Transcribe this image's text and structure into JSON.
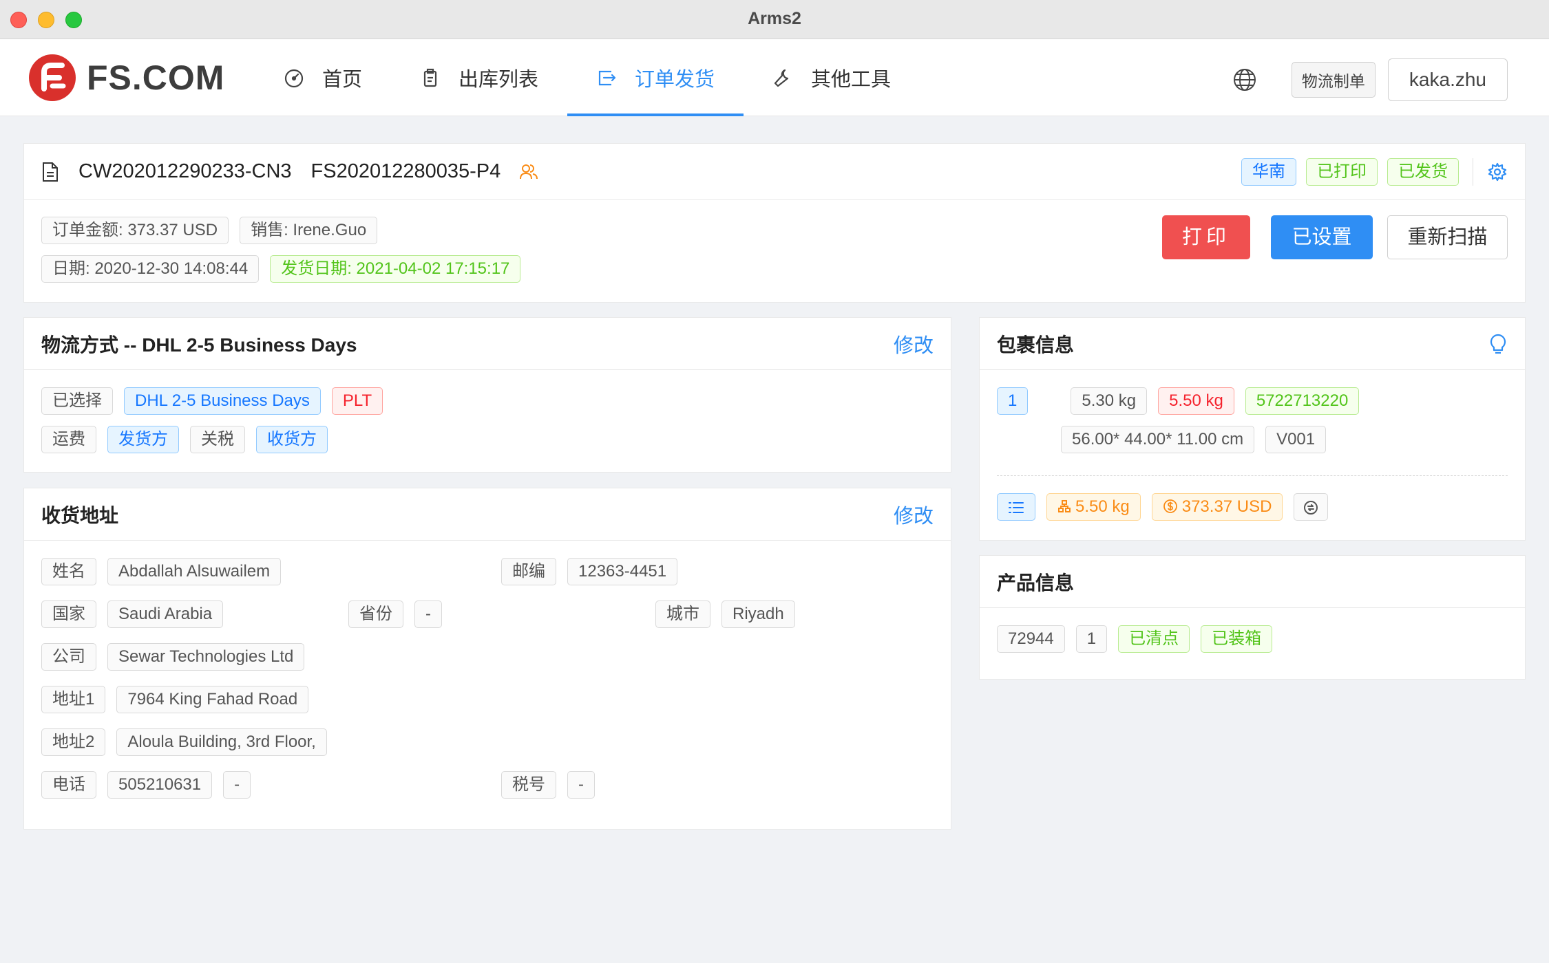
{
  "window": {
    "title": "Arms2"
  },
  "header": {
    "logo_text": "FS.COM",
    "nav": [
      {
        "label": "首页",
        "icon": "dashboard-icon"
      },
      {
        "label": "出库列表",
        "icon": "clipboard-icon"
      },
      {
        "label": "订单发货",
        "icon": "export-icon",
        "active": true
      },
      {
        "label": "其他工具",
        "icon": "wrench-icon"
      }
    ],
    "logistics_button": "物流制单",
    "user": "kaka.zhu"
  },
  "order": {
    "id": "CW202012290233-CN3",
    "ref": "FS202012280035-P4",
    "badges": [
      "华南",
      "已打印",
      "已发货"
    ],
    "amount": "订单金额: 373.37 USD",
    "sales": "销售: Irene.Guo",
    "date": "日期: 2020-12-30 14:08:44",
    "ship_date": "发货日期: 2021-04-02 17:15:17",
    "print_label": "打印",
    "set_label": "已设置",
    "rescan_label": "重新扫描"
  },
  "shipping": {
    "title": "物流方式 -- DHL 2-5 Business Days",
    "edit": "修改",
    "selected_label": "已选择",
    "method": "DHL 2-5 Business Days",
    "method_type": "PLT",
    "freight_label": "运费",
    "freight_payer": "发货方",
    "duty_label": "关税",
    "duty_payer": "收货方"
  },
  "address": {
    "title": "收货地址",
    "edit": "修改",
    "name_label": "姓名",
    "name": "Abdallah Alsuwailem",
    "zip_label": "邮编",
    "zip": "12363-4451",
    "country_label": "国家",
    "country": "Saudi Arabia",
    "province_label": "省份",
    "province": "-",
    "city_label": "城市",
    "city": "Riyadh",
    "company_label": "公司",
    "company": "Sewar Technologies Ltd",
    "addr1_label": "地址1",
    "addr1": "7964 King Fahad Road",
    "addr2_label": "地址2",
    "addr2": "Aloula Building, 3rd Floor,",
    "phone_label": "电话",
    "phone": "505210631",
    "phone_ext": "-",
    "tax_label": "税号",
    "tax": "-"
  },
  "package": {
    "title": "包裹信息",
    "index": "1",
    "net_weight": "5.30 kg",
    "gross_weight": "5.50 kg",
    "tracking": "5722713220",
    "dimensions": "56.00* 44.00* 11.00 cm",
    "box": "V001",
    "total_weight": "5.50 kg",
    "total_value": "373.37 USD"
  },
  "product": {
    "title": "产品信息",
    "id": "72944",
    "qty": "1",
    "status1": "已清点",
    "status2": "已装箱"
  },
  "colors": {
    "accent": "#2f8ef4",
    "danger": "#f05050",
    "success": "#52c41a",
    "warning": "#fa8c16"
  }
}
